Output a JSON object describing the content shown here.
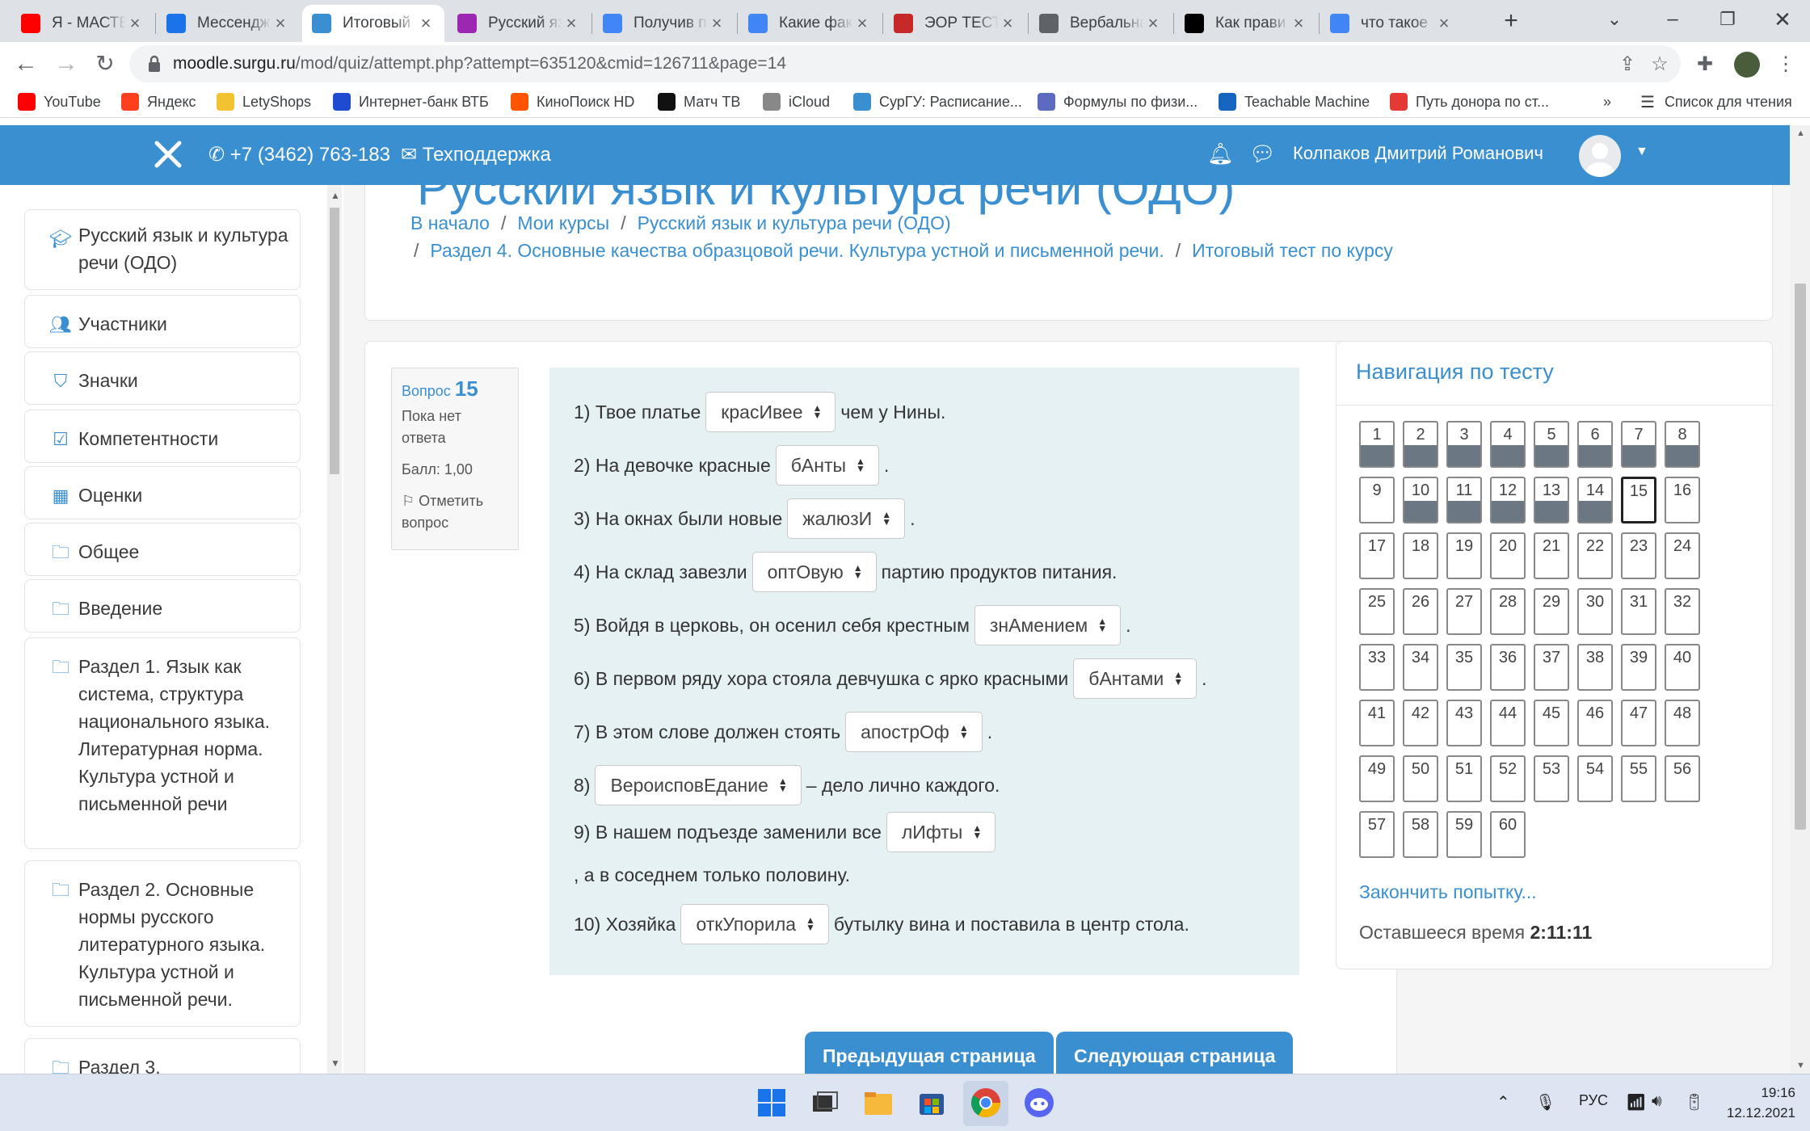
{
  "browser": {
    "tabs": [
      {
        "label": "Я - МАСТЕ",
        "icon": "youtube-icon",
        "color": "#ff0000"
      },
      {
        "label": "Мессендж",
        "icon": "messenger-icon",
        "color": "#1a73e8"
      },
      {
        "label": "Итоговый",
        "icon": "moodle-icon",
        "color": "#3a8fd0",
        "active": true
      },
      {
        "label": "Русский яз",
        "icon": "course-icon",
        "color": "#9c27b0"
      },
      {
        "label": "Получив п",
        "icon": "google-icon",
        "color": "#4285f4"
      },
      {
        "label": "Какие фак",
        "icon": "google-icon",
        "color": "#4285f4"
      },
      {
        "label": "ЭОР ТЕСТ",
        "icon": "folder-icon",
        "color": "#c62828"
      },
      {
        "label": "Вербальна",
        "icon": "globe-icon",
        "color": "#5f6368"
      },
      {
        "label": "Как прави",
        "icon": "medium-icon",
        "color": "#000000"
      },
      {
        "label": "что такое",
        "icon": "google-icon",
        "color": "#4285f4"
      }
    ],
    "url_host": "moodle.surgu.ru",
    "url_path": "/mod/quiz/attempt.php?attempt=635120&cmid=126711&page=14",
    "bookmarks": [
      {
        "label": "YouTube",
        "icon": "youtube-icon",
        "color": "#ff0000"
      },
      {
        "label": "Яндекс",
        "icon": "yandex-icon",
        "color": "#fc3f1d"
      },
      {
        "label": "LetyShops",
        "icon": "letyshops-icon",
        "color": "#f2c230"
      },
      {
        "label": "Интернет-банк ВТБ",
        "icon": "vtb-icon",
        "color": "#1e4bd2"
      },
      {
        "label": "КиноПоиск HD",
        "icon": "kinopoisk-icon",
        "color": "#ff5500"
      },
      {
        "label": "Матч ТВ",
        "icon": "match-tv-icon",
        "color": "#111111"
      },
      {
        "label": "iCloud",
        "icon": "apple-icon",
        "color": "#888888"
      },
      {
        "label": "СурГУ: Расписание...",
        "icon": "surgu-icon",
        "color": "#3a8fd0"
      },
      {
        "label": "Формулы по физи...",
        "icon": "formulas-icon",
        "color": "#5c6bc0"
      },
      {
        "label": "Teachable Machine",
        "icon": "teachable-machine-icon",
        "color": "#1565c0"
      },
      {
        "label": "Путь донора по ст...",
        "icon": "donor-icon",
        "color": "#e53935"
      }
    ],
    "bookmarks_more": "»",
    "reading_list": "Список для чтения"
  },
  "header": {
    "phone": "+7 (3462) 763-183",
    "support": "Техподдержка",
    "user_name": "Колпаков Дмитрий Романович"
  },
  "sidebar": {
    "items": [
      {
        "label": "Русский язык и культура речи (ОДО)",
        "icon": "graduation-cap-icon"
      },
      {
        "label": "Участники",
        "icon": "users-icon"
      },
      {
        "label": "Значки",
        "icon": "shield-icon"
      },
      {
        "label": "Компетентности",
        "icon": "checkbox-icon"
      },
      {
        "label": "Оценки",
        "icon": "table-icon"
      },
      {
        "label": "Общее",
        "icon": "folder-icon"
      },
      {
        "label": "Введение",
        "icon": "folder-icon"
      },
      {
        "label": "Раздел 1. Язык как система, структура национального языка. Литературная норма. Культура устной и письменной речи",
        "icon": "folder-icon"
      },
      {
        "label": "Раздел 2. Основные нормы русского литературного языка. Культура устной и письменной речи.",
        "icon": "folder-icon"
      },
      {
        "label": "Раздел 3.",
        "icon": "folder-icon"
      }
    ]
  },
  "course": {
    "title": "Русский язык и культура речи (ОДО)",
    "breadcrumb": [
      "В начало",
      "Мои курсы",
      "Русский язык и культура речи (ОДО)",
      "Раздел 4. Основные качества образцовой речи. Культура устной и письменной речи.",
      "Итоговый тест по курсу"
    ]
  },
  "question": {
    "label": "Вопрос",
    "number": "15",
    "status": "Пока нет ответа",
    "score": "Балл: 1,00",
    "flag": "Отметить вопрос",
    "lines": [
      {
        "before": "1) Твое платье",
        "select": "красИвее",
        "after": "чем у Нины."
      },
      {
        "before": "2) На девочке красные",
        "select": "бАнты",
        "after": "."
      },
      {
        "before": "3) На окнах были новые",
        "select": "жалюзИ",
        "after": "."
      },
      {
        "before": "4) На склад завезли",
        "select": "оптОвую",
        "after": "партию продуктов питания."
      },
      {
        "before": "5) Войдя в церковь, он осенил себя крестным",
        "select": "знАмением",
        "after": "."
      },
      {
        "before": "6) В первом ряду хора стояла девчушка с ярко красными",
        "select": "бАнтами",
        "after": "."
      },
      {
        "before": "7) В этом слове должен стоять",
        "select": "апострОф",
        "after": "."
      },
      {
        "before": "8)",
        "select": "ВероисповЕдание",
        "after": "– дело лично каждого."
      },
      {
        "before": "9) В нашем подъезде заменили все",
        "select": "лИфты",
        "after": ", а в соседнем только половину."
      },
      {
        "before": "10) Хозяйка",
        "select": "откУпорила",
        "after": "бутылку вина и поставила в центр стола."
      }
    ],
    "prev_button": "Предыдущая страница",
    "next_button": "Следующая страница"
  },
  "quiz_nav": {
    "title": "Навигация по тесту",
    "total": 60,
    "answered": [
      1,
      2,
      3,
      4,
      5,
      6,
      7,
      8,
      10,
      11,
      12,
      13,
      14
    ],
    "current": 15,
    "finish": "Закончить попытку...",
    "time_label": "Оставшееся время",
    "time_value": "2:11:11"
  },
  "taskbar": {
    "lang": "РУС",
    "time": "19:16",
    "date": "12.12.2021"
  }
}
